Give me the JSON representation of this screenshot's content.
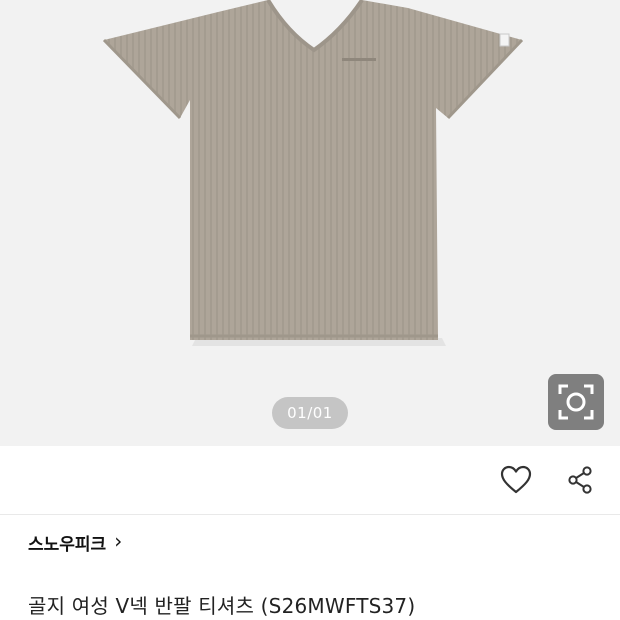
{
  "gallery": {
    "counter": "01/01",
    "background": "#f2f2f2",
    "shirt_color": "#aea599",
    "lens_icon": "lens-search-icon"
  },
  "actions": {
    "like_icon": "heart-icon",
    "share_icon": "share-icon"
  },
  "product": {
    "brand": "스노우피크",
    "brand_chevron": "›",
    "title": "골지 여성 V넥 반팔 티셔츠 (S26MWFTS37)"
  }
}
